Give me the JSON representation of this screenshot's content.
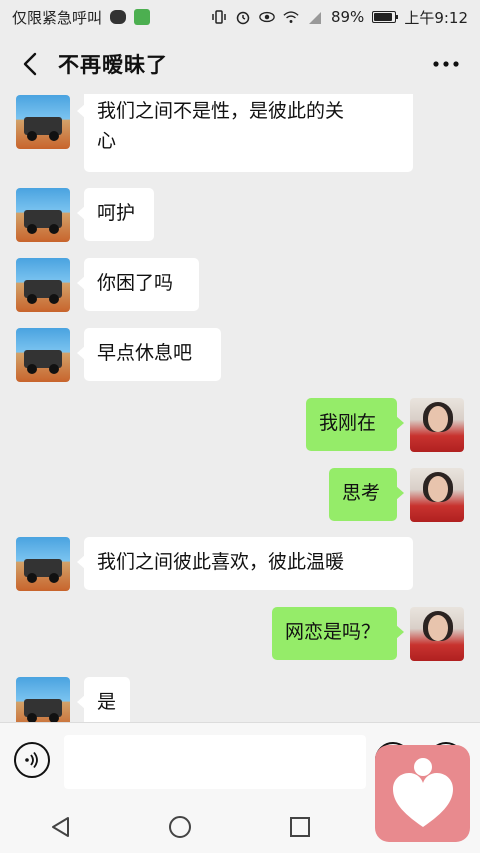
{
  "status_bar": {
    "carrier": "仅限紧急呼叫",
    "battery": "89%",
    "time": "上午9:12"
  },
  "header": {
    "title": "不再暧昧了"
  },
  "messages": [
    {
      "side": "left",
      "text": "我们之间不是性，是彼此的关\n心"
    },
    {
      "side": "left",
      "text": "呵护"
    },
    {
      "side": "left",
      "text": "你困了吗"
    },
    {
      "side": "left",
      "text": "早点休息吧"
    },
    {
      "side": "right",
      "text": "我刚在"
    },
    {
      "side": "right",
      "text": "思考"
    },
    {
      "side": "left",
      "text": "我们之间彼此喜欢，彼此温暖"
    },
    {
      "side": "right",
      "text": "网恋是吗？"
    },
    {
      "side": "left",
      "text": "是"
    }
  ],
  "input": {
    "value": "",
    "placeholder": ""
  },
  "icons": {
    "back": "chevron-left-icon",
    "more": "more-dots-icon",
    "voice": "voice-icon",
    "emoji": "emoji-icon",
    "plus": "plus-icon",
    "nav_back": "triangle-back-icon",
    "nav_home": "circle-home-icon",
    "nav_recent": "square-recent-icon",
    "overlay": "heart-person-icon"
  },
  "colors": {
    "background": "#ededed",
    "bubble_left": "#ffffff",
    "bubble_right": "#95ec69",
    "overlay": "#e88a8e"
  }
}
